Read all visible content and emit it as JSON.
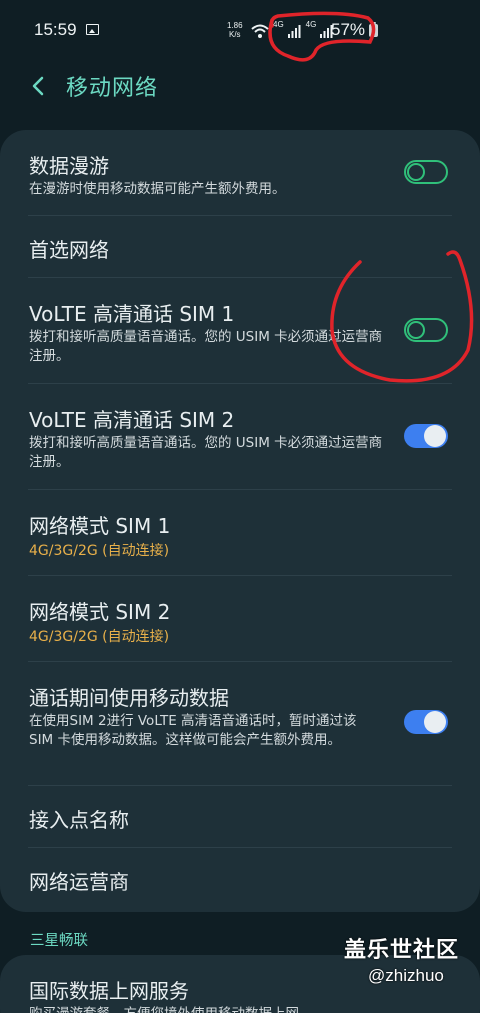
{
  "status": {
    "time": "15:59",
    "speed_value": "1.86",
    "speed_unit": "K/s",
    "network_label_1": "4G",
    "network_label_2": "4G",
    "battery_percent": "57%"
  },
  "header": {
    "title": "移动网络"
  },
  "settings": {
    "data_roaming": {
      "title": "数据漫游",
      "subtitle": "在漫游时使用移动数据可能产生额外费用。",
      "enabled": false
    },
    "preferred_network": {
      "title": "首选网络"
    },
    "volte_sim1": {
      "title": "VoLTE 高清通话 SIM 1",
      "subtitle": "拨打和接听高质量语音通话。您的 USIM 卡必须通过运营商注册。",
      "enabled": false
    },
    "volte_sim2": {
      "title": "VoLTE 高清通话 SIM 2",
      "subtitle": "拨打和接听高质量语音通话。您的 USIM 卡必须通过运营商注册。",
      "enabled": true
    },
    "network_mode_sim1": {
      "title": "网络模式 SIM 1",
      "value": "4G/3G/2G (自动连接)"
    },
    "network_mode_sim2": {
      "title": "网络模式 SIM 2",
      "value": "4G/3G/2G (自动连接)"
    },
    "data_during_calls": {
      "title": "通话期间使用移动数据",
      "subtitle": "在使用SIM 2进行 VoLTE 高清语音通话时，暂时通过该 SIM 卡使用移动数据。这样做可能会产生额外费用。",
      "enabled": true
    },
    "access_point_names": {
      "title": "接入点名称"
    },
    "network_operators": {
      "title": "网络运营商"
    }
  },
  "section": {
    "header": "三星畅联",
    "international_data": {
      "title": "国际数据上网服务",
      "subtitle": "购买漫游套餐，方便您境外使用移动数据上网。"
    }
  },
  "watermark": {
    "title": "盖乐世社区",
    "handle": "@zhizhuo"
  },
  "colors": {
    "background": "#0f1e24",
    "card": "#1e3038",
    "accent": "#6cd9c2",
    "toggle_on": "#3d7ff0",
    "toggle_off_outline": "#30c07a",
    "value_text": "#e8b04a",
    "annotation": "#e0242a"
  },
  "icons": [
    "image-icon",
    "wifi-icon",
    "signal-icon",
    "battery-icon",
    "back-arrow-icon"
  ]
}
